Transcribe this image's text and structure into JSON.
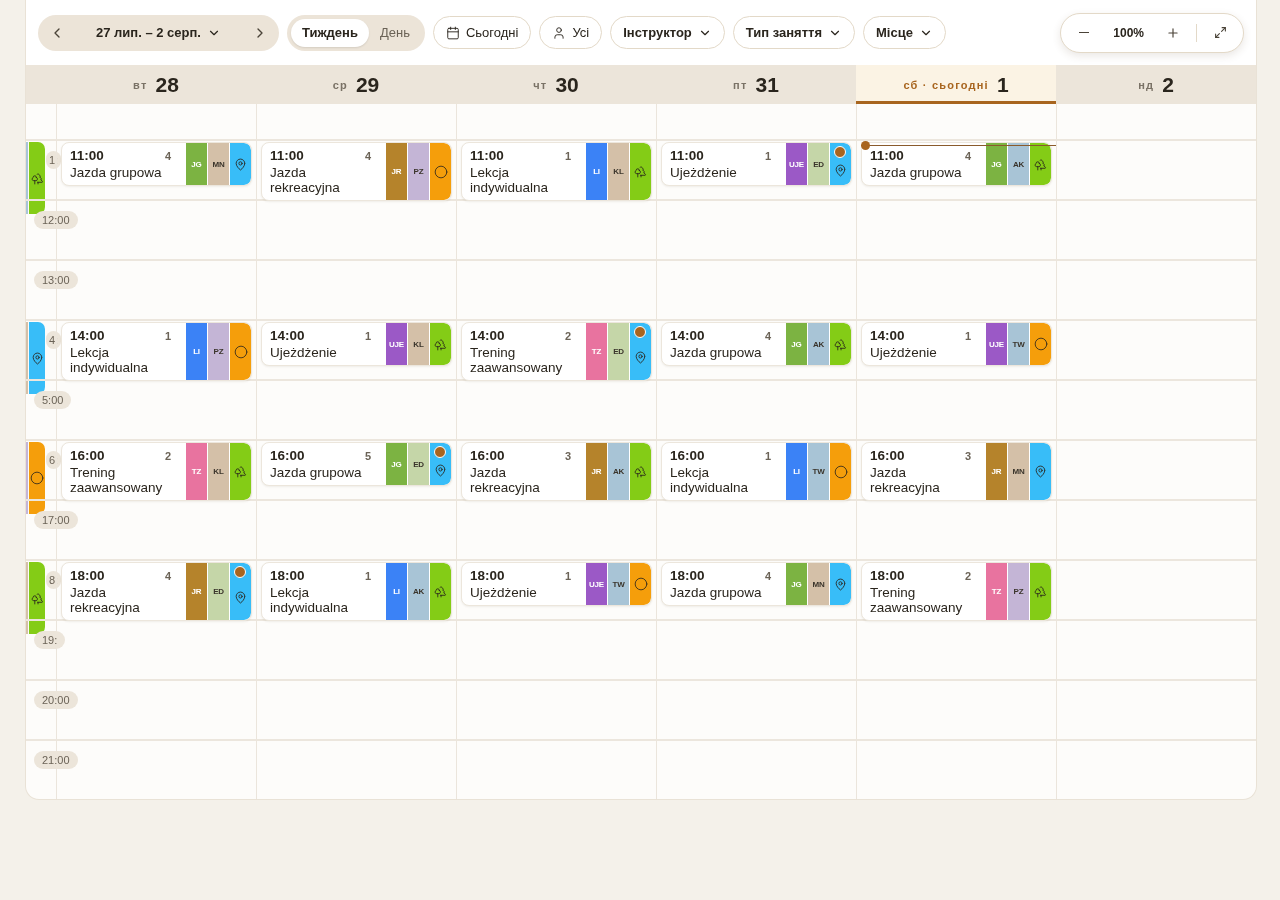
{
  "toolbar": {
    "date_range": "27 лип. – 2 серп.",
    "views": [
      {
        "label": "Тиждень",
        "selected": true
      },
      {
        "label": "День",
        "selected": false
      }
    ],
    "today_button": "Сьогодні",
    "people_button": "Усі",
    "filters": [
      "Інструктор",
      "Тип заняття",
      "Місце"
    ],
    "zoom": "100%"
  },
  "days": [
    {
      "weekday": "вт",
      "number": "28",
      "today": false
    },
    {
      "weekday": "ср",
      "number": "29",
      "today": false
    },
    {
      "weekday": "чт",
      "number": "30",
      "today": false
    },
    {
      "weekday": "пт",
      "number": "31",
      "today": false
    },
    {
      "weekday": "сб · сьогодні",
      "number": "1",
      "today": true
    },
    {
      "weekday": "нд",
      "number": "2",
      "today": false
    }
  ],
  "rows": [
    {
      "label": "1:",
      "now_indicator": true,
      "clipped": {
        "color": "#a8c4d6",
        "venue": {
          "kind": "tree"
        }
      },
      "events": [
        {
          "time": "11:00",
          "count": "4",
          "title": "Jazda grupowa",
          "type": {
            "code": "JG",
            "color": "#7cb342"
          },
          "instructor": {
            "code": "MN",
            "color": "#d4c0a8"
          },
          "venue": {
            "kind": "pin"
          },
          "flagged": false
        },
        {
          "time": "11:00",
          "count": "4",
          "title": "Jazda rekreacyjna",
          "type": {
            "code": "JR",
            "color": "#b5832b"
          },
          "instructor": {
            "code": "PZ",
            "color": "#c4b5d6"
          },
          "venue": {
            "kind": "ring"
          },
          "flagged": false
        },
        {
          "time": "11:00",
          "count": "1",
          "title": "Lekcja indywidualna",
          "type": {
            "code": "LI",
            "color": "#3b82f6"
          },
          "instructor": {
            "code": "KL",
            "color": "#d4c0a8"
          },
          "venue": {
            "kind": "tree"
          },
          "flagged": false
        },
        {
          "time": "11:00",
          "count": "1",
          "title": "Ujeżdżenie",
          "type": {
            "code": "UJE",
            "color": "#9b59c6"
          },
          "instructor": {
            "code": "ED",
            "color": "#c5d6a8"
          },
          "venue": {
            "kind": "pin"
          },
          "flagged": true
        },
        {
          "time": "11:00",
          "count": "4",
          "title": "Jazda grupowa",
          "type": {
            "code": "JG",
            "color": "#7cb342"
          },
          "instructor": {
            "code": "AK",
            "color": "#a8c4d6"
          },
          "venue": {
            "kind": "tree"
          },
          "flagged": false
        }
      ]
    },
    {
      "label": "12:00"
    },
    {
      "label": "13:00"
    },
    {
      "label": "4:",
      "clipped": {
        "color": "#d4c0a8",
        "venue": {
          "kind": "pin"
        }
      },
      "events": [
        {
          "time": "14:00",
          "count": "1",
          "title": "Lekcja indywidualna",
          "type": {
            "code": "LI",
            "color": "#3b82f6"
          },
          "instructor": {
            "code": "PZ",
            "color": "#c4b5d6"
          },
          "venue": {
            "kind": "ring"
          },
          "flagged": false
        },
        {
          "time": "14:00",
          "count": "1",
          "title": "Ujeżdżenie",
          "type": {
            "code": "UJE",
            "color": "#9b59c6"
          },
          "instructor": {
            "code": "KL",
            "color": "#d4c0a8"
          },
          "venue": {
            "kind": "tree"
          },
          "flagged": false
        },
        {
          "time": "14:00",
          "count": "2",
          "title": "Trening zaawansowany",
          "type": {
            "code": "TZ",
            "color": "#e8739f"
          },
          "instructor": {
            "code": "ED",
            "color": "#c5d6a8"
          },
          "venue": {
            "kind": "pin"
          },
          "flagged": true
        },
        {
          "time": "14:00",
          "count": "4",
          "title": "Jazda grupowa",
          "type": {
            "code": "JG",
            "color": "#7cb342"
          },
          "instructor": {
            "code": "AK",
            "color": "#a8c4d6"
          },
          "venue": {
            "kind": "tree"
          },
          "flagged": false
        },
        {
          "time": "14:00",
          "count": "1",
          "title": "Ujeżdżenie",
          "type": {
            "code": "UJE",
            "color": "#9b59c6"
          },
          "instructor": {
            "code": "TW",
            "color": "#a8c4d6"
          },
          "venue": {
            "kind": "ring"
          },
          "flagged": false
        }
      ]
    },
    {
      "label": "5:00"
    },
    {
      "label": "6:",
      "clipped": {
        "color": "#c4b5d6",
        "venue": {
          "kind": "ring"
        }
      },
      "events": [
        {
          "time": "16:00",
          "count": "2",
          "title": "Trening zaawansowany",
          "type": {
            "code": "TZ",
            "color": "#e8739f"
          },
          "instructor": {
            "code": "KL",
            "color": "#d4c0a8"
          },
          "venue": {
            "kind": "tree"
          },
          "flagged": false
        },
        {
          "time": "16:00",
          "count": "5",
          "title": "Jazda grupowa",
          "type": {
            "code": "JG",
            "color": "#7cb342"
          },
          "instructor": {
            "code": "ED",
            "color": "#c5d6a8"
          },
          "venue": {
            "kind": "pin"
          },
          "flagged": true
        },
        {
          "time": "16:00",
          "count": "3",
          "title": "Jazda rekreacyjna",
          "type": {
            "code": "JR",
            "color": "#b5832b"
          },
          "instructor": {
            "code": "AK",
            "color": "#a8c4d6"
          },
          "venue": {
            "kind": "tree"
          },
          "flagged": false
        },
        {
          "time": "16:00",
          "count": "1",
          "title": "Lekcja indywidualna",
          "type": {
            "code": "LI",
            "color": "#3b82f6"
          },
          "instructor": {
            "code": "TW",
            "color": "#a8c4d6"
          },
          "venue": {
            "kind": "ring"
          },
          "flagged": false
        },
        {
          "time": "16:00",
          "count": "3",
          "title": "Jazda rekreacyjna",
          "type": {
            "code": "JR",
            "color": "#b5832b"
          },
          "instructor": {
            "code": "MN",
            "color": "#d4c0a8"
          },
          "venue": {
            "kind": "pin"
          },
          "flagged": false
        }
      ]
    },
    {
      "label": "17:00"
    },
    {
      "label": "8:",
      "clipped": {
        "color": "#d4c0a8",
        "venue": {
          "kind": "tree"
        }
      },
      "events": [
        {
          "time": "18:00",
          "count": "4",
          "title": "Jazda rekreacyjna",
          "type": {
            "code": "JR",
            "color": "#b5832b"
          },
          "instructor": {
            "code": "ED",
            "color": "#c5d6a8"
          },
          "venue": {
            "kind": "pin"
          },
          "flagged": true
        },
        {
          "time": "18:00",
          "count": "1",
          "title": "Lekcja indywidualna",
          "type": {
            "code": "LI",
            "color": "#3b82f6"
          },
          "instructor": {
            "code": "AK",
            "color": "#a8c4d6"
          },
          "venue": {
            "kind": "tree"
          },
          "flagged": false
        },
        {
          "time": "18:00",
          "count": "1",
          "title": "Ujeżdżenie",
          "type": {
            "code": "UJE",
            "color": "#9b59c6"
          },
          "instructor": {
            "code": "TW",
            "color": "#a8c4d6"
          },
          "venue": {
            "kind": "ring"
          },
          "flagged": false
        },
        {
          "time": "18:00",
          "count": "4",
          "title": "Jazda grupowa",
          "type": {
            "code": "JG",
            "color": "#7cb342"
          },
          "instructor": {
            "code": "MN",
            "color": "#d4c0a8"
          },
          "venue": {
            "kind": "pin"
          },
          "flagged": false
        },
        {
          "time": "18:00",
          "count": "2",
          "title": "Trening zaawansowany",
          "type": {
            "code": "TZ",
            "color": "#e8739f"
          },
          "instructor": {
            "code": "PZ",
            "color": "#c4b5d6"
          },
          "venue": {
            "kind": "tree"
          },
          "flagged": false
        }
      ]
    },
    {
      "label": "19:"
    },
    {
      "label": "20:00"
    },
    {
      "label": "21:00"
    }
  ]
}
